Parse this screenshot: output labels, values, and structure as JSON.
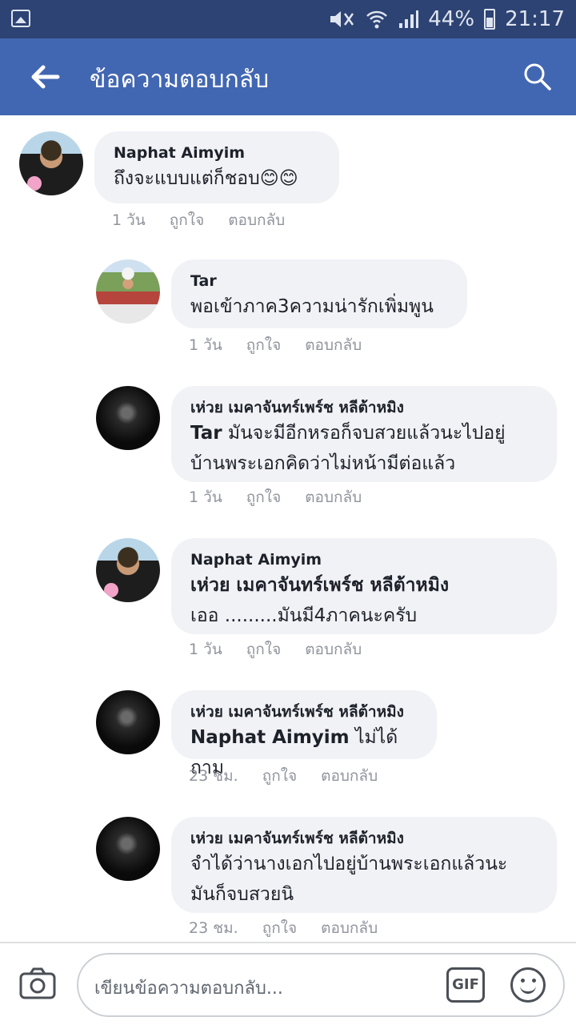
{
  "status_bar": {
    "battery_pct": "44%",
    "time": "21:17"
  },
  "header": {
    "title": "ข้อความตอบกลับ"
  },
  "actions": {
    "like": "ถูกใจ",
    "reply": "ตอบกลับ"
  },
  "comments": [
    {
      "author": "Naphat Aimyim",
      "text": "ถึงจะแบบแต่ก็ชอบ😊😊",
      "time": "1 วัน"
    },
    {
      "author": "Tar",
      "text": "พอเข้าภาค3ความน่ารักเพิ่มพูน",
      "time": "1 วัน"
    },
    {
      "author": "เห่วย เมคาจันทร์เพร์ช หลีต้าหมิง",
      "mention": "Tar",
      "text_line1": "มันจะมีอีกหรอก็จบสวยแล้วนะไปอยู่",
      "text_line2": "บ้านพระเอกคิดว่าไม่หน้ามีต่อแล้ว",
      "time": "1 วัน"
    },
    {
      "author": "Naphat Aimyim",
      "mention": "เห่วย เมคาจันทร์เพร์ช หลีต้าหมิง",
      "text": "เออ  .........มันมี4ภาคนะครับ",
      "time": "1 วัน"
    },
    {
      "author": "เห่วย เมคาจันทร์เพร์ช หลีต้าหมิง",
      "mention": "Naphat Aimyim",
      "text": "ไม่ได้ถาม",
      "time": "23 ชม."
    },
    {
      "author": "เห่วย เมคาจันทร์เพร์ช หลีต้าหมิง",
      "text_line1": "จำได้ว่านางเอกไปอยู่บ้านพระเอกแล้วนะ",
      "text_line2": "มันก็จบสวยนิ",
      "time": "23 ชม."
    }
  ],
  "composer": {
    "placeholder": "เขียนข้อความตอบกลับ...",
    "gif_label": "GIF"
  }
}
